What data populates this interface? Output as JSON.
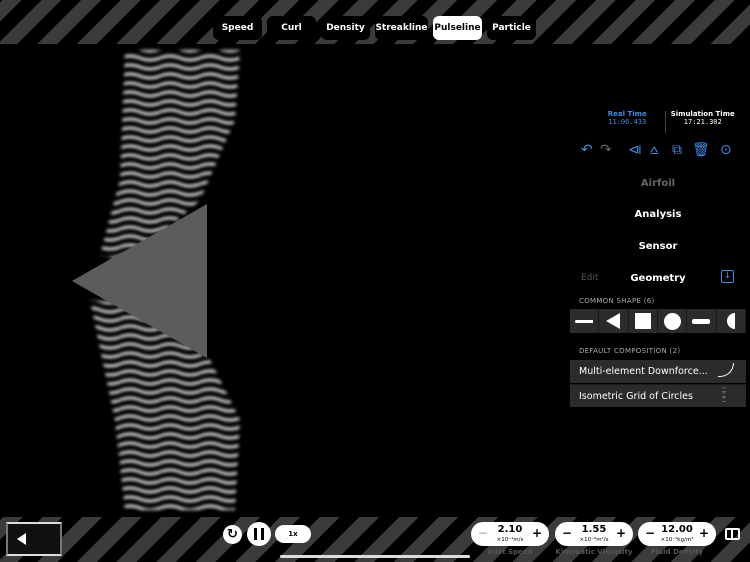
{
  "tabs": [
    "Speed",
    "Curl",
    "Density",
    "Streakline",
    "Pulseline",
    "Particle"
  ],
  "active_tab": "Pulseline",
  "time": {
    "real_label": "Real Time",
    "real_value": "11:06.433",
    "sim_label": "Simulation Time",
    "sim_value": "17:21.302"
  },
  "toolbar_icons": [
    "undo-icon",
    "redo-icon",
    "mirror-icon",
    "align-icon",
    "duplicate-icon",
    "trash-icon",
    "more-icon"
  ],
  "menu": {
    "airfoil": "Airfoil",
    "analysis": "Analysis",
    "sensor": "Sensor",
    "edit": "Edit",
    "geometry": "Geometry"
  },
  "common_shape_label": "COMMON SHAPE (6)",
  "shapes": [
    "airfoil",
    "triangle",
    "square",
    "circle",
    "flat-plate",
    "half-circle"
  ],
  "default_composition_label": "DEFAULT COMPOSITION (2)",
  "compositions": [
    "Multi-element Downforce...",
    "Isometric Grid of Circles"
  ],
  "playback": {
    "speed": "1x"
  },
  "params": [
    {
      "value": "2.10",
      "unit": "×10⁻¹m/s",
      "label": "Inlet Speed"
    },
    {
      "value": "1.55",
      "unit": "×10⁻⁵m²/s",
      "label": "Kinematic Viscosity"
    },
    {
      "value": "12.00",
      "unit": "×10⁻¹kg/m³",
      "label": "Fluid Density"
    }
  ],
  "colors": {
    "accent": "#3a8ee6",
    "panel": "#2b2b2b"
  }
}
